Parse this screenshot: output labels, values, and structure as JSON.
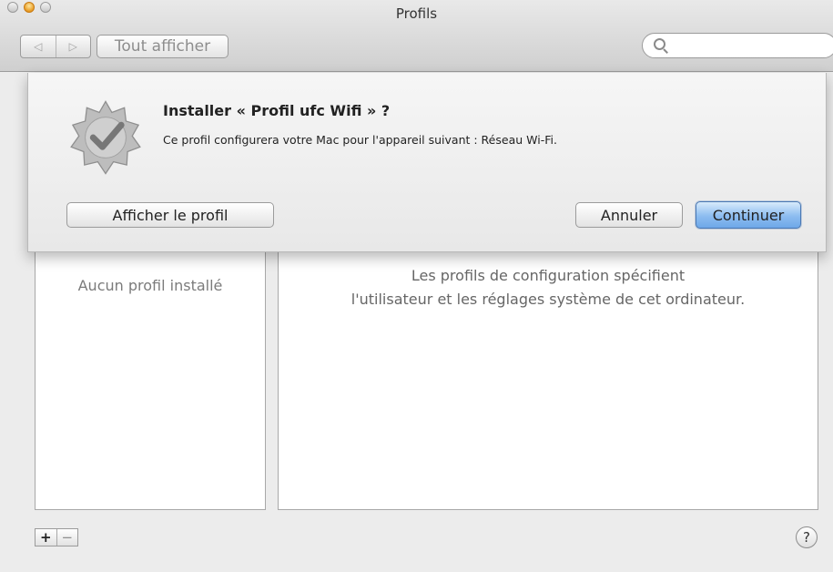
{
  "window": {
    "title": "Profils"
  },
  "toolbar": {
    "back_icon": "◁",
    "forward_icon": "▷",
    "show_all_label": "Tout afficher",
    "search_placeholder": ""
  },
  "sheet": {
    "title": "Installer « Profil ufc Wifi » ?",
    "message": "Ce profil configurera votre Mac pour l'appareil suivant : Réseau Wi-Fi.",
    "show_profile_label": "Afficher le profil",
    "cancel_label": "Annuler",
    "continue_label": "Continuer"
  },
  "profiles_list": {
    "empty_label": "Aucun profil installé"
  },
  "detail": {
    "line1": "Les profils de configuration spécifient",
    "line2": "l'utilisateur et les réglages système de cet ordinateur."
  },
  "footer": {
    "add_label": "+",
    "remove_label": "−",
    "help_label": "?"
  },
  "colors": {
    "accent": "#6ea8e8",
    "window_bg": "#ececec"
  }
}
